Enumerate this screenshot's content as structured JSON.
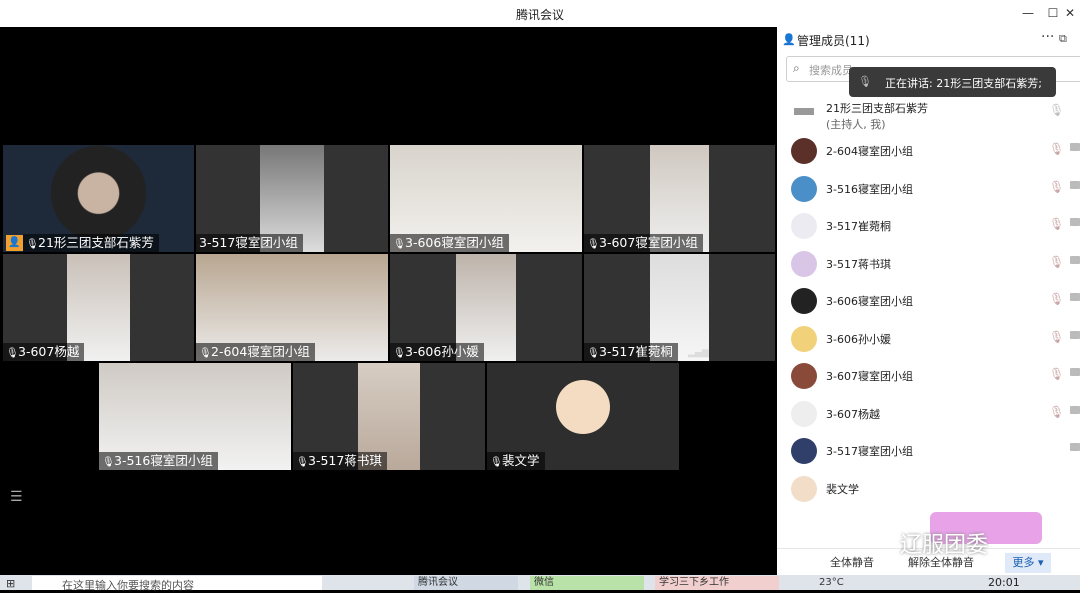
{
  "window": {
    "title": "腾讯会议"
  },
  "video_tiles": [
    {
      "name": "21形三团支部石紫芳",
      "host": true
    },
    {
      "name": "3-517寝室团小组"
    },
    {
      "name": "3-606寝室团小组"
    },
    {
      "name": "3-607寝室团小组"
    },
    {
      "name": "3-607杨越"
    },
    {
      "name": "2-604寝室团小组"
    },
    {
      "name": "3-606孙小媛"
    },
    {
      "name": "3-517崔菀桐"
    },
    {
      "name": "3-516寝室团小组"
    },
    {
      "name": "3-517蒋书琪"
    },
    {
      "name": "裴文学"
    }
  ],
  "panel": {
    "title": "管理成员(11)",
    "search_placeholder": "搜索成员",
    "tooltip": "正在讲话: 21形三团支部石紫芳;",
    "members": [
      {
        "name": "21形三团支部石紫芳",
        "sub": "(主持人, 我)"
      },
      {
        "name": "2-604寝室团小组"
      },
      {
        "name": "3-516寝室团小组"
      },
      {
        "name": "3-517崔菀桐"
      },
      {
        "name": "3-517蒋书琪"
      },
      {
        "name": "3-606寝室团小组"
      },
      {
        "name": "3-606孙小媛"
      },
      {
        "name": "3-607寝室团小组"
      },
      {
        "name": "3-607杨越"
      },
      {
        "name": "3-517寝室团小组"
      },
      {
        "name": "裴文学"
      }
    ],
    "footer": {
      "mute_all": "全体静音",
      "unmute_all": "解除全体静音",
      "more": "更多"
    }
  },
  "watermark": "辽服团委",
  "taskbar": {
    "search_placeholder": "在这里输入你要搜索的内容",
    "items": [
      "腾讯会议",
      "微信",
      "学习三下乡工作"
    ],
    "weather": "23°C",
    "time": "20:01"
  },
  "colors": {
    "host_badge": "#f0a030",
    "more_button": "#dfe9f7",
    "tooltip_bg": "#3a3a3a"
  }
}
